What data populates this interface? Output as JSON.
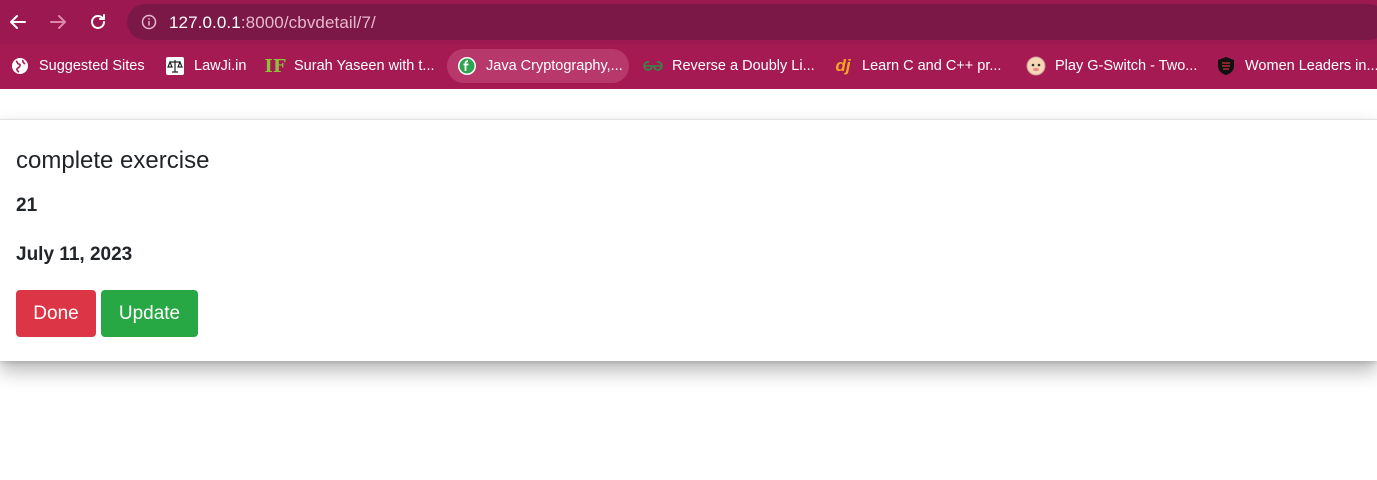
{
  "browser": {
    "url_host": "127.0.0.1",
    "url_rest": ":8000/cbvdetail/7/",
    "bookmarks": [
      {
        "label": "Suggested Sites",
        "icon": "globe-icon"
      },
      {
        "label": "LawJi.in",
        "icon": "scales-icon"
      },
      {
        "label": "Surah Yaseen with t...",
        "icon": "if-logo-icon"
      },
      {
        "label": "Java Cryptography,...",
        "icon": "tutorial-logo-icon"
      },
      {
        "label": "Reverse a Doubly Li...",
        "icon": "gfg-logo-icon"
      },
      {
        "label": "Learn C and C++ pr...",
        "icon": "programiz-logo-icon"
      },
      {
        "label": "Play G-Switch - Two...",
        "icon": "game-face-icon"
      },
      {
        "label": "Women Leaders in...",
        "icon": "shield-crest-icon"
      }
    ]
  },
  "task": {
    "title": "complete exercise",
    "number": "21",
    "date": "July 11, 2023",
    "done_label": "Done",
    "update_label": "Update"
  },
  "colors": {
    "done": "#dc3545",
    "update": "#28a745",
    "browser_bar": "#9c1850"
  }
}
